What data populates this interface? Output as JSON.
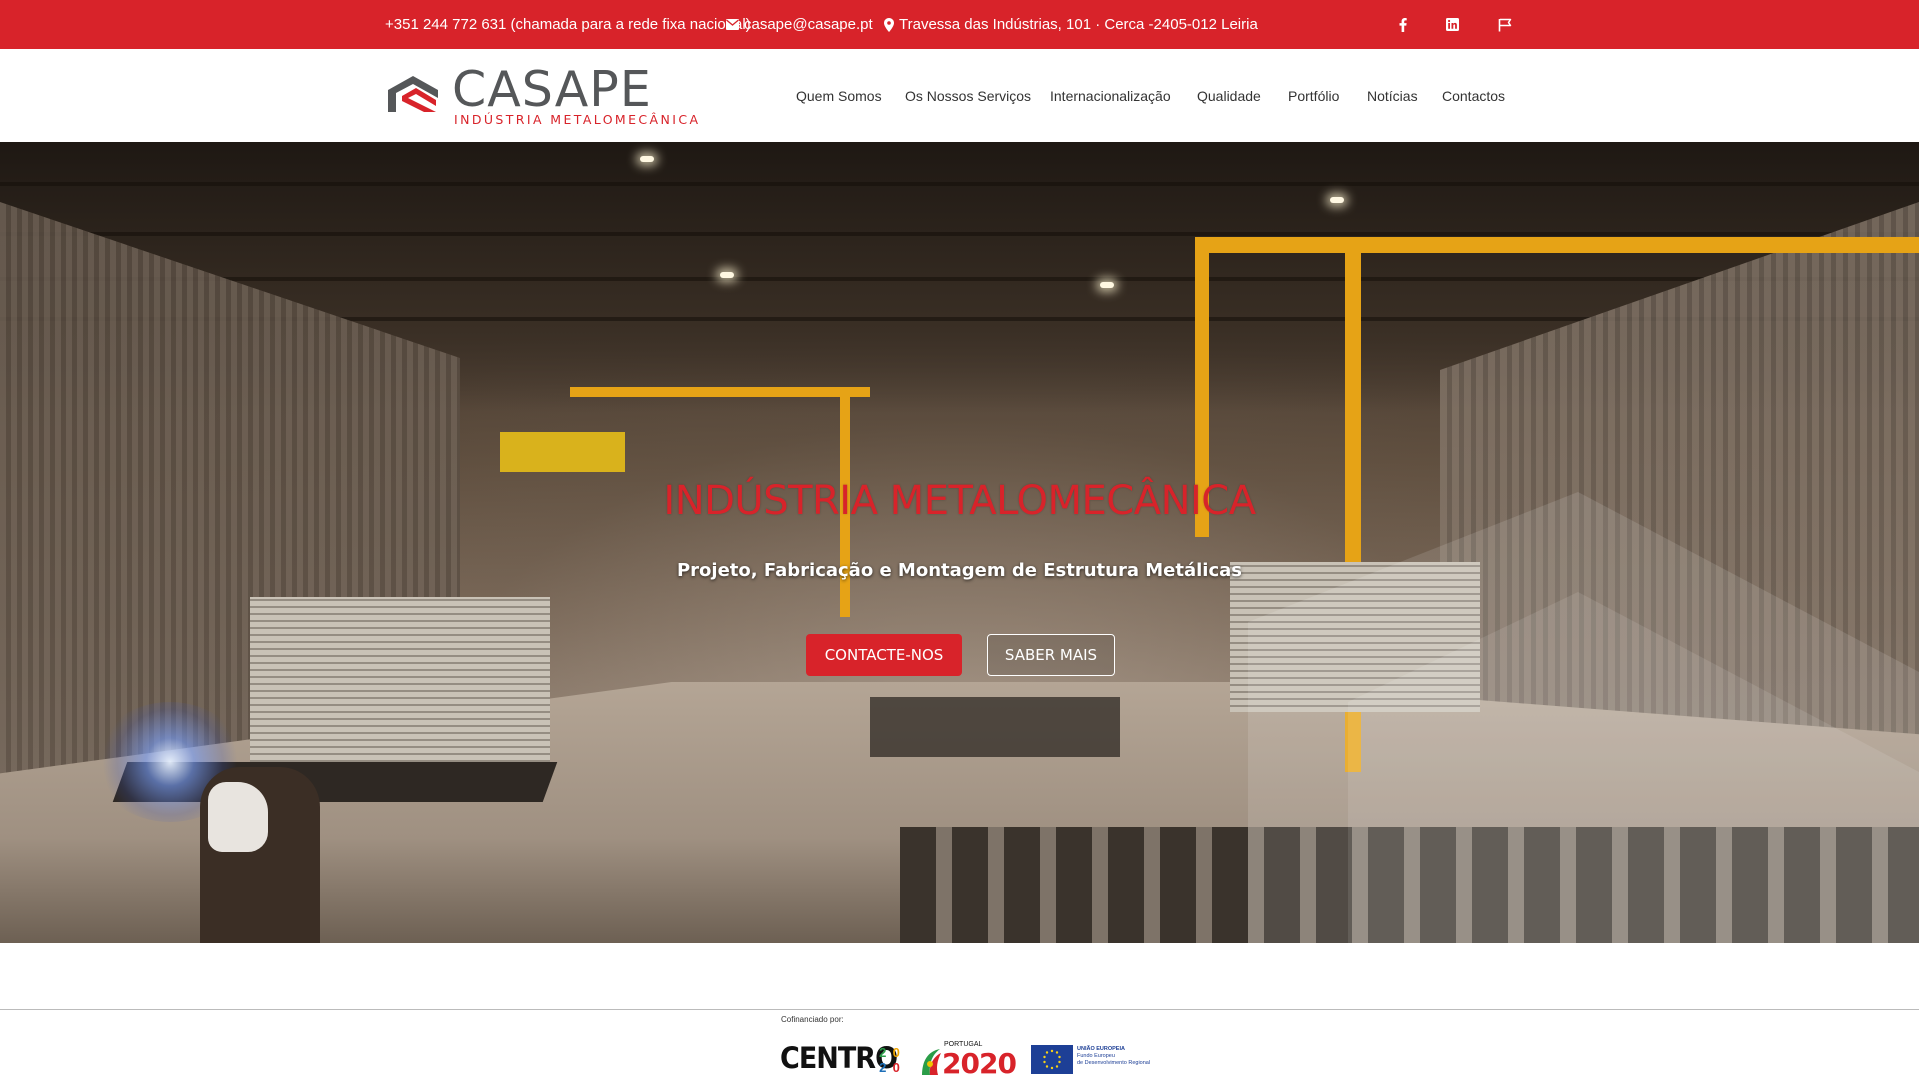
{
  "colors": {
    "brand_red": "#d8232a",
    "logo_gray": "#555759",
    "nav_text": "#333333"
  },
  "topbar": {
    "phone": "+351 244 772 631 (chamada para a rede fixa nacional)",
    "email": "casape@casape.pt",
    "address": "Travessa das Indústrias, 101 · Cerca -2405-012 Leiria",
    "icons": [
      "envelope-icon",
      "map-marker-icon",
      "facebook-icon",
      "linkedin-icon",
      "flag-icon"
    ]
  },
  "header": {
    "logo_name": "CASAPE",
    "logo_tagline": "INDÚSTRIA METALOMECÂNICA",
    "nav": [
      {
        "label": "Quem Somos"
      },
      {
        "label": "Os Nossos Serviços"
      },
      {
        "label": "Internacionalização"
      },
      {
        "label": "Qualidade"
      },
      {
        "label": "Portfólio"
      },
      {
        "label": "Notícias"
      },
      {
        "label": "Contactos"
      }
    ]
  },
  "hero": {
    "title": "INDÚSTRIA METALOMECÂNICA",
    "subtitle": "Projeto, Fabricação e Montagem de Estrutura Metálicas",
    "primary_button": "CONTACTE-NOS",
    "secondary_button": "SABER MAIS"
  },
  "cofinancing": {
    "label": "Cofinanciado por:",
    "centro": "CENTRO",
    "centro_digits": [
      "2",
      "0",
      "2",
      "0"
    ],
    "portugal_label": "PORTUGAL",
    "portugal_year": "2020",
    "eu_lines": [
      "UNIÃO EUROPEIA",
      "Fundo Europeu",
      "de Desenvolvimento Regional"
    ]
  }
}
